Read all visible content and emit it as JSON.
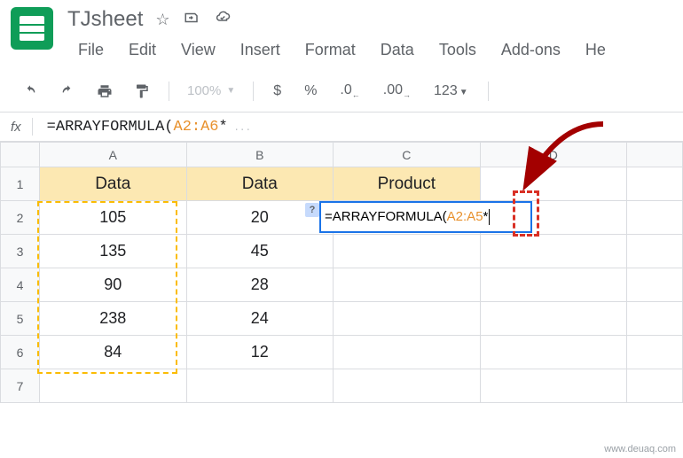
{
  "doc": {
    "title": "TJsheet"
  },
  "menubar": [
    "File",
    "Edit",
    "View",
    "Insert",
    "Format",
    "Data",
    "Tools",
    "Add-ons",
    "He"
  ],
  "toolbar": {
    "zoom": "100%",
    "currency": "$",
    "percent": "%",
    "dec_dec": ".0",
    "dec_inc": ".00",
    "numfmt": "123"
  },
  "formula_bar": {
    "fx": "fx",
    "prefix": "=ARRAYFORMULA(",
    "range": "A2:A6",
    "suffix": "*"
  },
  "columns": [
    "A",
    "B",
    "C",
    "D"
  ],
  "rows": [
    "1",
    "2",
    "3",
    "4",
    "5",
    "6",
    "7"
  ],
  "headers": {
    "a": "Data",
    "b": "Data",
    "c": "Product"
  },
  "table": [
    {
      "a": "105",
      "b": "20"
    },
    {
      "a": "135",
      "b": "45"
    },
    {
      "a": "90",
      "b": "28"
    },
    {
      "a": "238",
      "b": "24"
    },
    {
      "a": "84",
      "b": "12"
    }
  ],
  "editing": {
    "help": "?",
    "prefix": "=ARRAYFORMULA(",
    "range": "A2:A5",
    "suffix": "*"
  },
  "watermark": "www.deuaq.com"
}
